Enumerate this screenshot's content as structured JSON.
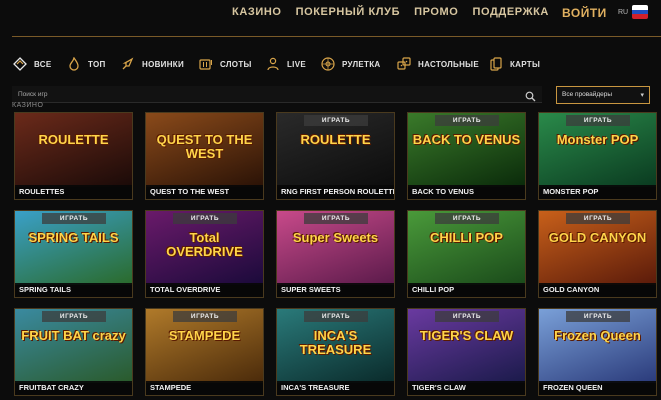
{
  "nav": {
    "links": [
      "КАЗИНО",
      "ПОКЕРНЫЙ КЛУБ",
      "ПРОМО",
      "ПОДДЕРЖКА"
    ],
    "login": "ВОЙТИ",
    "lang": "RU",
    "flag_colors": [
      "#ffffff",
      "#1f4fbf",
      "#d0202a"
    ]
  },
  "categories": [
    {
      "label": "ВСЕ",
      "icon": "diamond-icon"
    },
    {
      "label": "ТОП",
      "icon": "flame-icon"
    },
    {
      "label": "НОВИНКИ",
      "icon": "rocket-icon"
    },
    {
      "label": "СЛОТЫ",
      "icon": "slot-machine-icon"
    },
    {
      "label": "LIVE",
      "icon": "dealer-icon"
    },
    {
      "label": "РУЛЕТКА",
      "icon": "roulette-icon"
    },
    {
      "label": "НАСТОЛЬНЫЕ",
      "icon": "dice-icon"
    },
    {
      "label": "КАРТЫ",
      "icon": "cards-icon"
    }
  ],
  "search": {
    "placeholder": "Поиск игр"
  },
  "provider": {
    "selected": "Все провайдеры"
  },
  "section_title": "КАЗИНО",
  "play_label": "ИГРАТЬ",
  "accent_color": "#d9a54a",
  "games": [
    {
      "name": "ROULETTES",
      "logo": "ROULETTE",
      "bg": [
        "#6b2a1a",
        "#1a0a08"
      ],
      "play": false
    },
    {
      "name": "QUEST TO THE WEST",
      "logo": "QUEST TO THE WEST",
      "bg": [
        "#8a4a1a",
        "#2a1206"
      ],
      "play": false
    },
    {
      "name": "RNG FIRST PERSON ROULETTE",
      "logo": "ROULETTE",
      "bg": [
        "#2a2a2a",
        "#0c0c0c"
      ],
      "play": true
    },
    {
      "name": "BACK TO VENUS",
      "logo": "BACK TO VENUS",
      "bg": [
        "#3a7a2a",
        "#0a2a0a"
      ],
      "play": true
    },
    {
      "name": "MONSTER POP",
      "logo": "Monster POP",
      "bg": [
        "#2a8a4a",
        "#0a3a20"
      ],
      "play": true
    },
    {
      "name": "SPRING TAILS",
      "logo": "SPRING TAILS",
      "bg": [
        "#3aa0c8",
        "#2a6a2a"
      ],
      "play": true
    },
    {
      "name": "TOTAL OVERDRIVE",
      "logo": "Total OVERDRIVE",
      "bg": [
        "#6a1a6a",
        "#1a0a3a"
      ],
      "play": true
    },
    {
      "name": "SUPER SWEETS",
      "logo": "Super Sweets",
      "bg": [
        "#c84a8a",
        "#5a1a4a"
      ],
      "play": true
    },
    {
      "name": "CHILLI POP",
      "logo": "CHILLI POP",
      "bg": [
        "#4a9a3a",
        "#1a4a1a"
      ],
      "play": true
    },
    {
      "name": "GOLD CANYON",
      "logo": "GOLD CANYON",
      "bg": [
        "#c8601a",
        "#5a1a0a"
      ],
      "play": true
    },
    {
      "name": "FRUITBAT CRAZY",
      "logo": "FRUIT BAT crazy",
      "bg": [
        "#3a8aa0",
        "#2a5a2a"
      ],
      "play": true
    },
    {
      "name": "STAMPEDE",
      "logo": "STAMPEDE",
      "bg": [
        "#b07a2a",
        "#4a2a0a"
      ],
      "play": true
    },
    {
      "name": "INCA'S TREASURE",
      "logo": "INCA'S TREASURE",
      "bg": [
        "#2a7a7a",
        "#0a2a2a"
      ],
      "play": true
    },
    {
      "name": "TIGER'S CLAW",
      "logo": "TIGER'S CLAW",
      "bg": [
        "#6a3aa0",
        "#1a1a4a"
      ],
      "play": true
    },
    {
      "name": "FROZEN QUEEN",
      "logo": "Frozen Queen",
      "bg": [
        "#7aa0d8",
        "#2a3a7a"
      ],
      "play": true
    }
  ]
}
